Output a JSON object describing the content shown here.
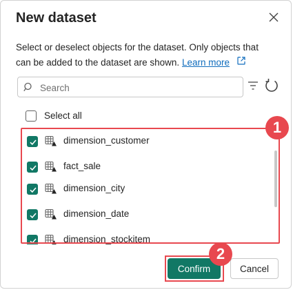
{
  "dialog": {
    "title": "New dataset",
    "description": "Select or deselect objects for the dataset. Only objects that can be added to the dataset are shown.",
    "link_text": "Learn more"
  },
  "search": {
    "placeholder": "Search",
    "value": ""
  },
  "select_all": {
    "label": "Select all",
    "checked": false
  },
  "items": [
    {
      "name": "dimension_customer",
      "checked": true,
      "icon": "table-icon"
    },
    {
      "name": "fact_sale",
      "checked": true,
      "icon": "table-icon"
    },
    {
      "name": "dimension_city",
      "checked": true,
      "icon": "table-icon"
    },
    {
      "name": "dimension_date",
      "checked": true,
      "icon": "table-icon"
    },
    {
      "name": "dimension_stockitem",
      "checked": true,
      "icon": "table-icon"
    }
  ],
  "callouts": [
    "1",
    "2"
  ],
  "buttons": {
    "confirm": "Confirm",
    "cancel": "Cancel"
  },
  "colors": {
    "accent": "#117865",
    "callout": "#e8484f",
    "link": "#0f6cbd"
  }
}
